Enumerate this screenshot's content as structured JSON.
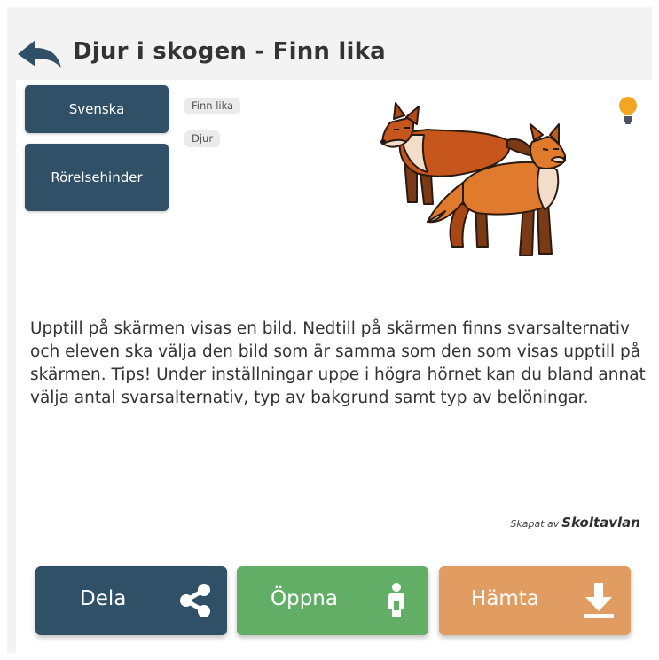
{
  "header": {
    "title": "Djur i skogen - Finn lika"
  },
  "tags": {
    "language": "Svenska",
    "need": "Rörelsehinder"
  },
  "chips": [
    "Finn lika",
    "Djur"
  ],
  "illustration": {
    "icon": "two-foxes-illustration"
  },
  "tip_icon": "lightbulb-icon",
  "description": "Upptill på skärmen visas en bild. Nedtill på skärmen finns svarsalternativ och eleven ska välja den bild som är samma som den som visas upptill på skärmen. Tips! Under inställningar uppe i högra hörnet kan du bland annat välja antal svarsalternativ, typ av bakgrund samt typ av belöningar.",
  "credit": {
    "prefix": "Skapat av",
    "brand": "Skoltavlan"
  },
  "actions": {
    "share_label": "Dela",
    "open_label": "Öppna",
    "download_label": "Hämta"
  },
  "colors": {
    "primary": "#2f5066",
    "open": "#63ae66",
    "download": "#e19c61",
    "bulb": "#f2a623"
  }
}
